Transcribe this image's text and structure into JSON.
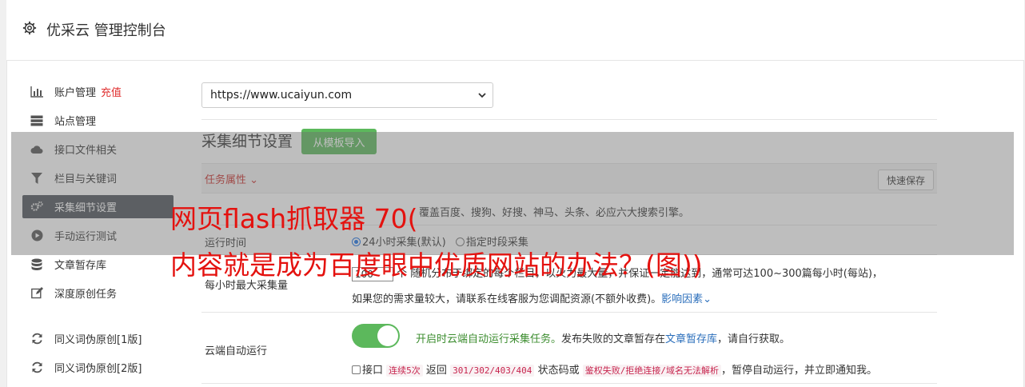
{
  "header": {
    "title": "优采云 管理控制台"
  },
  "sidebar": {
    "items": [
      {
        "label": "账户管理",
        "extra": "充值",
        "icon": "bar-chart-icon"
      },
      {
        "label": "站点管理",
        "icon": "server-icon"
      },
      {
        "label": "接口文件相关",
        "icon": "cloud-upload-icon"
      },
      {
        "label": "栏目与关键词",
        "icon": "filter-icon"
      },
      {
        "label": "采集细节设置",
        "icon": "gears-icon",
        "active": true
      },
      {
        "label": "手动运行测试",
        "icon": "play-circle-icon"
      },
      {
        "label": "文章暂存库",
        "icon": "database-icon"
      },
      {
        "label": "深度原创任务",
        "icon": "edit-icon"
      },
      {
        "label": "同义词伪原创[1版]",
        "icon": "refresh-icon"
      },
      {
        "label": "同义词伪原创[2版]",
        "icon": "refresh-icon"
      }
    ]
  },
  "site_select": {
    "value": "https://www.ucaiyun.com"
  },
  "section": {
    "title": "采集细节设置",
    "template_button": "从模板导入"
  },
  "table": {
    "attr_label": "任务属性 ⌄",
    "quick_save": "快速保存"
  },
  "rows": {
    "row1_tail": "覆盖百度、搜狗、好搜、神马、头条、必应六大搜索引擎。",
    "run_time": {
      "label": "运行时间",
      "opt1": "24小时采集(默认)",
      "opt2": "指定时段采集"
    },
    "max_per_hour": {
      "label": "每小时最大采集量",
      "value": "100",
      "line1": "个 随机分布于绑定的每个栏目，以火力最大量，并保证一定能达到，通常可达100~300篇每小时(每站)，",
      "line2": "如果您的需求量较大，请联系在线客服为您调配资源(不额外收费)。",
      "link": "影响因素"
    },
    "cloud_run": {
      "label": "云端自动运行",
      "desc_green": "开启时云端自动运行采集任务。",
      "desc_1": "发布失败的文章暂存在",
      "desc_link": "文章暂存库",
      "desc_2": "，请自行获取。",
      "chk_a": "接口",
      "code1": "连续5次",
      "chk_b": "返回",
      "code2": "301/302/403/404",
      "chk_c": "状态码或",
      "code3": "鉴权失败/拒绝连接/域名无法解析",
      "chk_d": "，暂停自动运行，并立即通知我。"
    }
  },
  "watermark": {
    "line1": "网页flash抓取器 70(",
    "line2": "内容就是成为百度眼中优质网站的办法？(图))"
  },
  "colors": {
    "accent_green": "#5cb85c",
    "danger_red": "#c9302c",
    "active_nav": "#4d5359"
  }
}
